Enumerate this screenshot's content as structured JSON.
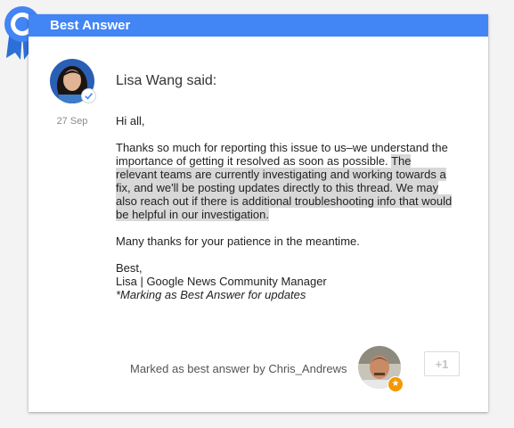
{
  "header": {
    "title": "Best Answer"
  },
  "post": {
    "author_said": "Lisa Wang said:",
    "date": "27 Sep",
    "greeting": "Hi all,",
    "para1_plain": "Thanks so much for reporting this issue to us–we understand the importance of getting it resolved as soon as possible. ",
    "para1_highlighted": "The relevant teams are currently investigating and working towards a fix, and we'll be posting updates directly to this thread. We may also reach out if there is additional troubleshooting info that would be helpful in our investigation.",
    "para2": "Many thanks for your patience in the meantime.",
    "signoff": "Best,",
    "signature": "Lisa | Google News Community Manager",
    "note": "*Marking as Best Answer for updates"
  },
  "footer": {
    "marked_by": "Marked as best answer by Chris_Andrews",
    "plus_one": "+1"
  },
  "colors": {
    "header_bg": "#4285f4",
    "highlight": "#d8d8d8",
    "star_badge": "#f29900"
  },
  "icons": {
    "ribbon": "best-answer-ribbon-icon",
    "verified": "check-icon",
    "star": "star-icon"
  }
}
